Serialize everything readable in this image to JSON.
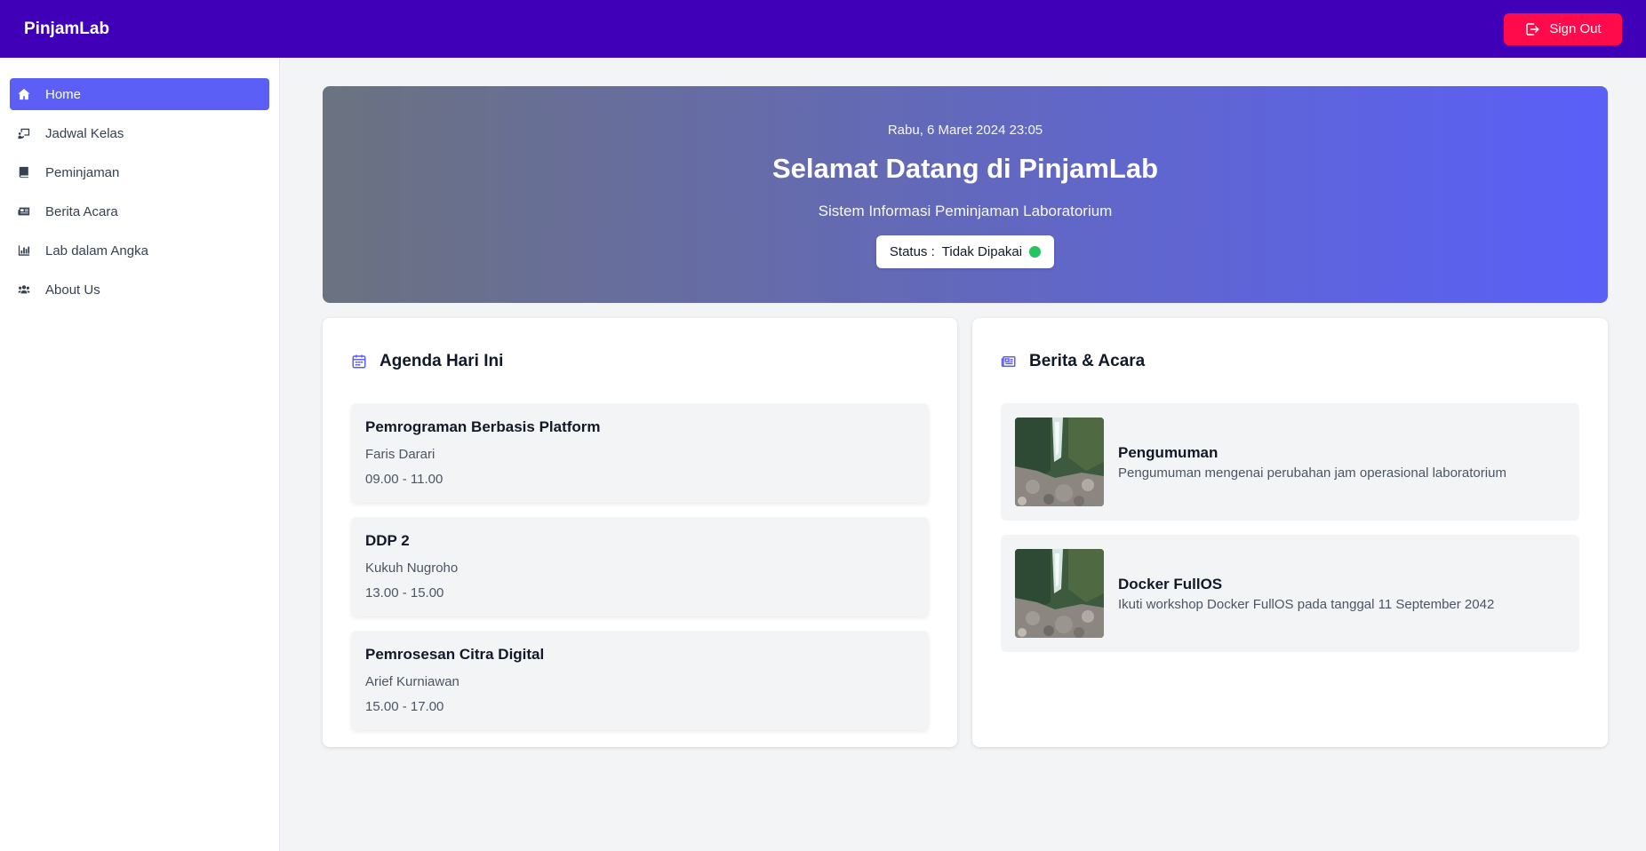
{
  "app": {
    "brand": "PinjamLab",
    "sign_out_label": "Sign Out"
  },
  "sidebar": {
    "items": [
      {
        "label": "Home",
        "icon": "home-icon",
        "active": true
      },
      {
        "label": "Jadwal Kelas",
        "icon": "chalkboard-icon",
        "active": false
      },
      {
        "label": "Peminjaman",
        "icon": "book-icon",
        "active": false
      },
      {
        "label": "Berita Acara",
        "icon": "newspaper-icon",
        "active": false
      },
      {
        "label": "Lab dalam Angka",
        "icon": "bar-chart-icon",
        "active": false
      },
      {
        "label": "About Us",
        "icon": "users-icon",
        "active": false
      }
    ]
  },
  "hero": {
    "datetime": "Rabu, 6 Maret 2024 23:05",
    "title": "Selamat Datang di PinjamLab",
    "subtitle": "Sistem Informasi Peminjaman Laboratorium",
    "status_label": "Status :",
    "status_value": "Tidak Dipakai",
    "status_color": "#22c55e"
  },
  "agenda": {
    "title": "Agenda Hari Ini",
    "items": [
      {
        "course": "Pemrograman Berbasis Platform",
        "teacher": "Faris Darari",
        "time": "09.00 - 11.00"
      },
      {
        "course": "DDP 2",
        "teacher": "Kukuh Nugroho",
        "time": "13.00 - 15.00"
      },
      {
        "course": "Pemrosesan Citra Digital",
        "teacher": "Arief Kurniawan",
        "time": "15.00 - 17.00"
      }
    ]
  },
  "news": {
    "title": "Berita & Acara",
    "items": [
      {
        "title": "Pengumuman",
        "desc": "Pengumuman mengenai perubahan jam operasional laboratorium"
      },
      {
        "title": "Docker FullOS",
        "desc": "Ikuti workshop Docker FullOS pada tanggal 11 September 2042"
      }
    ]
  },
  "colors": {
    "topbar": "#3f00b8",
    "accent": "#5b5ff6",
    "signout": "#ff0a4a"
  }
}
